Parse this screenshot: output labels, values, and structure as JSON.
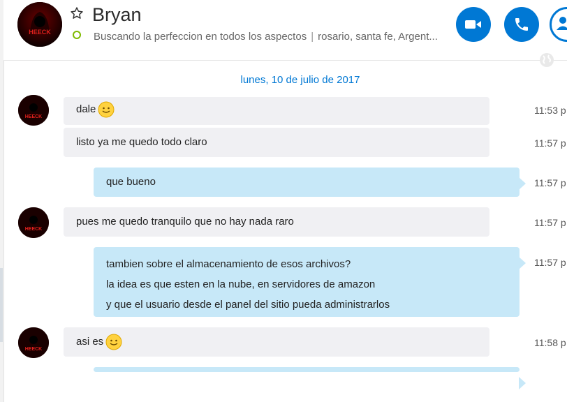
{
  "header": {
    "contact_name": "Bryan",
    "mood": "Buscando la perfeccion en todos los aspectos",
    "separator": "|",
    "location": "rosario, santa fe, Argent...",
    "avatar_logo_text": "HEECK",
    "icons": {
      "favorite": "star-outline-icon",
      "presence": "presence-status-icon",
      "video": "video-call-icon",
      "call": "phone-call-icon",
      "add": "add-contact-icon"
    }
  },
  "conversation": {
    "date": "lunes, 10 de julio de 2017",
    "messages": [
      {
        "direction": "in",
        "lines": [
          "dale"
        ],
        "emoji": true,
        "time": "11:53 p"
      },
      {
        "direction": "in",
        "lines": [
          "listo ya me quedo todo claro"
        ],
        "emoji": false,
        "time": "11:57 p"
      },
      {
        "direction": "out",
        "lines": [
          "que bueno"
        ],
        "emoji": false,
        "time": "11:57 p"
      },
      {
        "direction": "in",
        "lines": [
          "pues me quedo tranquilo que no hay nada raro"
        ],
        "emoji": false,
        "time": "11:57 p"
      },
      {
        "direction": "out",
        "lines": [
          "tambien sobre el almacenamiento de esos archivos?",
          "la idea es que esten en la nube, en servidores de amazon",
          "y que el usuario desde el panel del sitio pueda administrarlos"
        ],
        "emoji": false,
        "time": "11:57 p"
      },
      {
        "direction": "in",
        "lines": [
          "asi es"
        ],
        "emoji": true,
        "time": "11:58 p"
      }
    ]
  },
  "colors": {
    "accent": "#0078d4",
    "incoming_bubble": "#f0f0f3",
    "outgoing_bubble": "#c7e8f8",
    "presence": "#7fba00",
    "avatar_bg": "#140000",
    "avatar_logo": "#e0201c"
  }
}
